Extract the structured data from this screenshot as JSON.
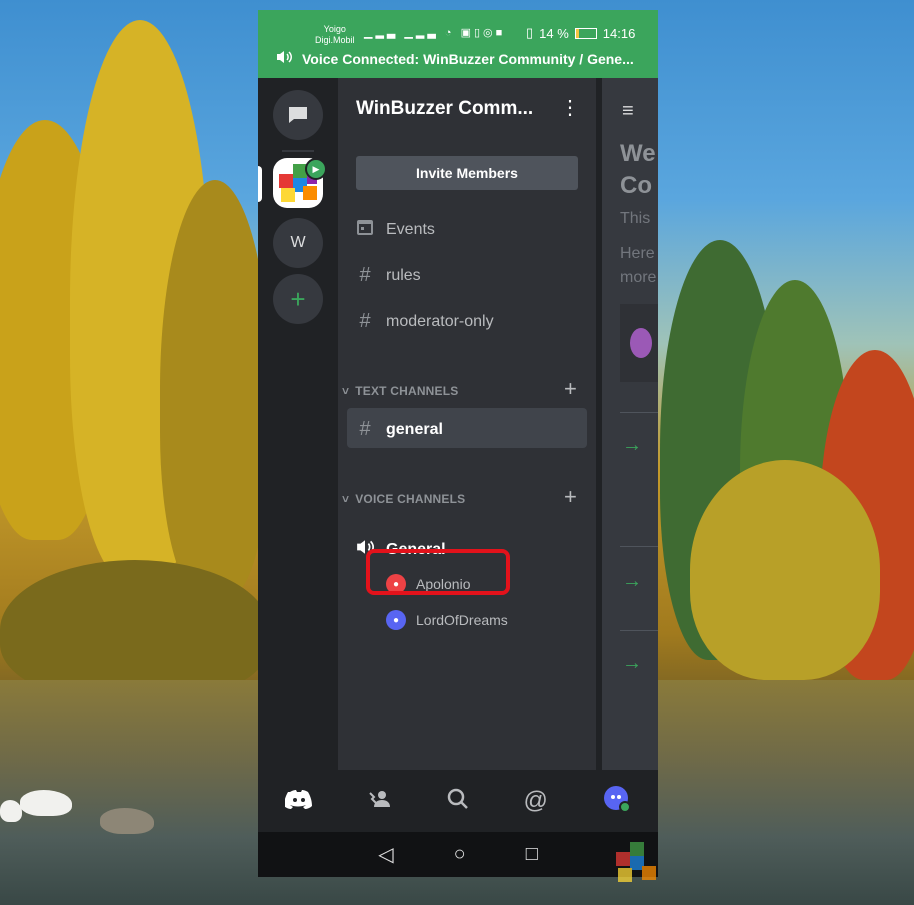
{
  "status_bar": {
    "carrier_1": "Yoigo",
    "carrier_2": "Digi.Mobil",
    "signal_icons": "▁▂▃ ▁▂▃",
    "battery_percent": "14 %",
    "time": "14:16"
  },
  "voice_bar": {
    "text": "Voice Connected: WinBuzzer Community / Gene..."
  },
  "server_rail": {
    "items": [
      "direct-messages",
      "winbuzzer-community",
      "w",
      "add-server"
    ],
    "w_label": "W",
    "add_label": "+"
  },
  "server": {
    "name": "WinBuzzer Comm...",
    "invite_label": "Invite Members"
  },
  "channels": {
    "top_items": [
      {
        "label": "Events"
      },
      {
        "label": "rules"
      },
      {
        "label": "moderator-only"
      }
    ],
    "text_category": "TEXT CHANNELS",
    "text_channels": [
      {
        "label": "general",
        "active": true
      }
    ],
    "voice_category": "VOICE CHANNELS",
    "voice_channels": [
      {
        "label": "General",
        "users": [
          {
            "name": "Apolonio",
            "avatar_color": "#ed4245",
            "highlighted": true
          },
          {
            "name": "LordOfDreams",
            "avatar_color": "#5865f2",
            "highlighted": false
          }
        ]
      }
    ]
  },
  "chat_peek": {
    "line1": "We",
    "line2": "Co",
    "line3": "This",
    "line4": "Here",
    "line5": "more"
  },
  "bottom_nav": [
    "home-icon",
    "friends-icon",
    "search-icon",
    "mentions-icon",
    "profile-icon"
  ],
  "colors": {
    "accent_green": "#3ba55c",
    "highlight_red": "#e3121b",
    "blurple": "#5865f2"
  }
}
